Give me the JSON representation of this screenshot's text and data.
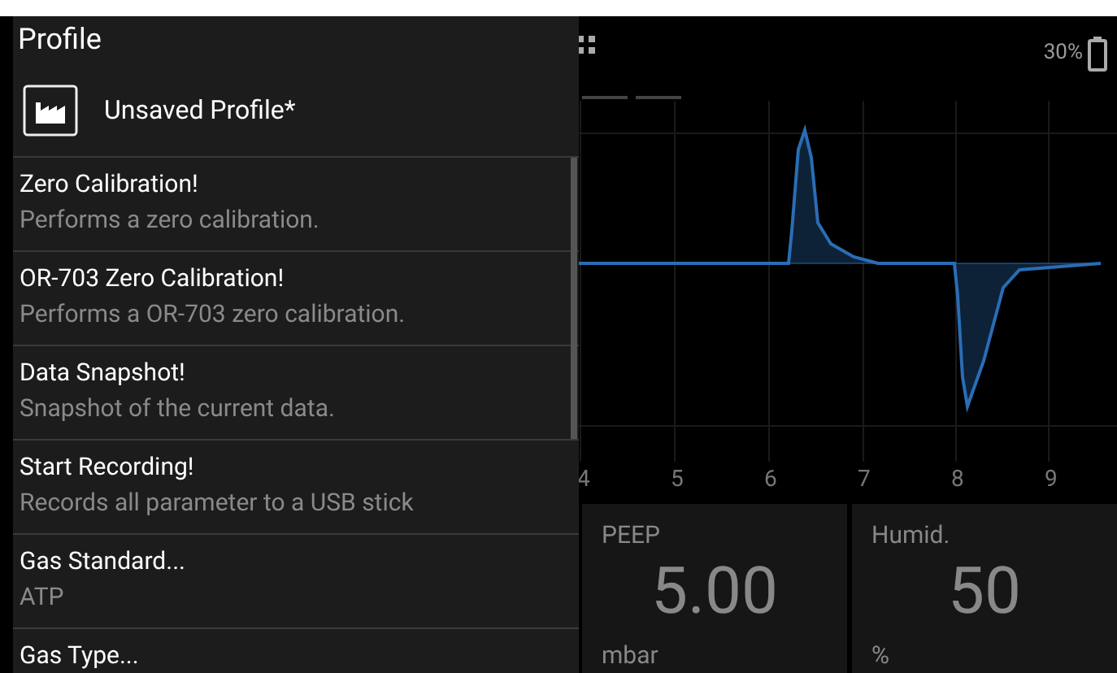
{
  "drawer": {
    "title": "Profile",
    "profile": {
      "label": "Unsaved Profile*"
    },
    "items": [
      {
        "title": "Zero Calibration!",
        "subtitle": "Performs a zero calibration."
      },
      {
        "title": "OR-703 Zero Calibration!",
        "subtitle": "Performs a OR-703 zero calibration."
      },
      {
        "title": "Data Snapshot!",
        "subtitle": "Snapshot of the current data."
      },
      {
        "title": "Start Recording!",
        "subtitle": "Records all parameter to a USB stick"
      },
      {
        "title": "Gas Standard...",
        "subtitle": "ATP"
      },
      {
        "title": "Gas Type..."
      }
    ]
  },
  "status": {
    "battery": "30%"
  },
  "waveform": {
    "x_axis_labels": [
      "4",
      "5",
      "6",
      "7",
      "8",
      "9"
    ]
  },
  "tiles": [
    {
      "label": "PEEP",
      "value": "5.00",
      "unit": "mbar"
    },
    {
      "label": "Humid.",
      "value": "50",
      "unit": "%"
    }
  ]
}
